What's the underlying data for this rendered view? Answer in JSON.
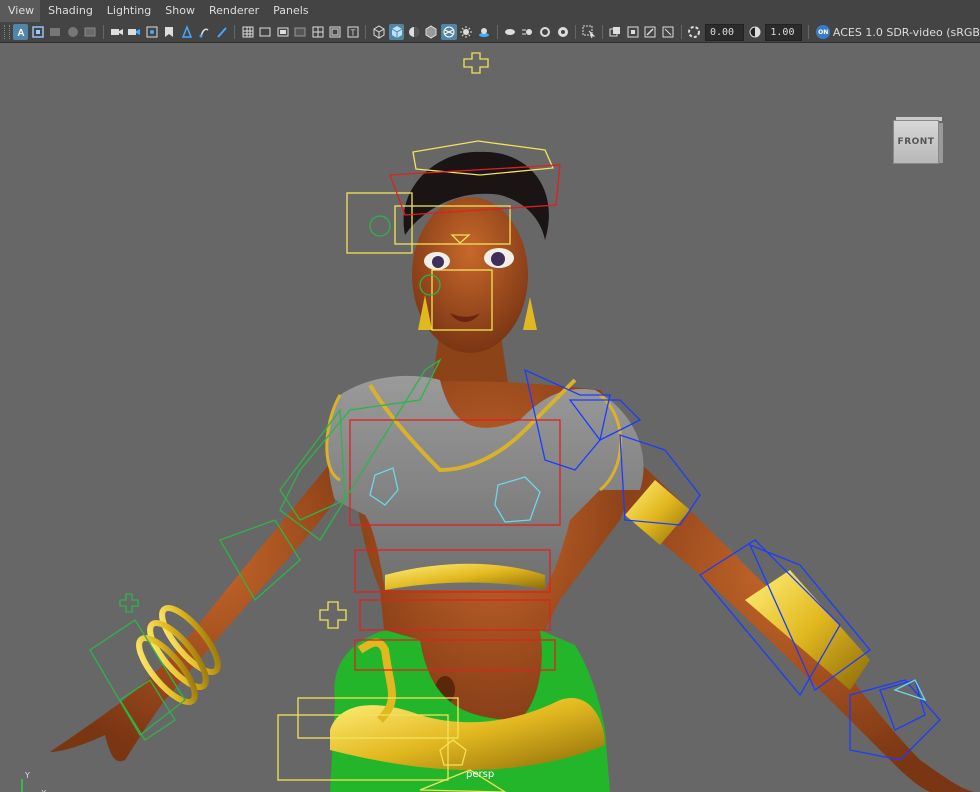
{
  "menu": [
    "View",
    "Shading",
    "Lighting",
    "Show",
    "Renderer",
    "Panels"
  ],
  "toolbar": {
    "exposure_value": "0.00",
    "gamma_value": "1.00",
    "color_space_badge": "ON",
    "color_space_label": "ACES 1.0 SDR-video (sRGB"
  },
  "viewport": {
    "camera": "persp",
    "viewcube_face": "FRONT",
    "axis_y": "Y",
    "axis_x": "X"
  },
  "colors": {
    "ui_bg": "#444444",
    "viewport_bg": "#676767",
    "active_button": "#5285a6",
    "rig_yellow": "#f2e35a",
    "rig_red": "#e02020",
    "rig_blue": "#1a3cff",
    "rig_green": "#2fb34a",
    "skin": "#a8521e",
    "top_gray": "#8a8a8a",
    "gold": "#d9b22a",
    "skirt_green": "#23b52a"
  }
}
